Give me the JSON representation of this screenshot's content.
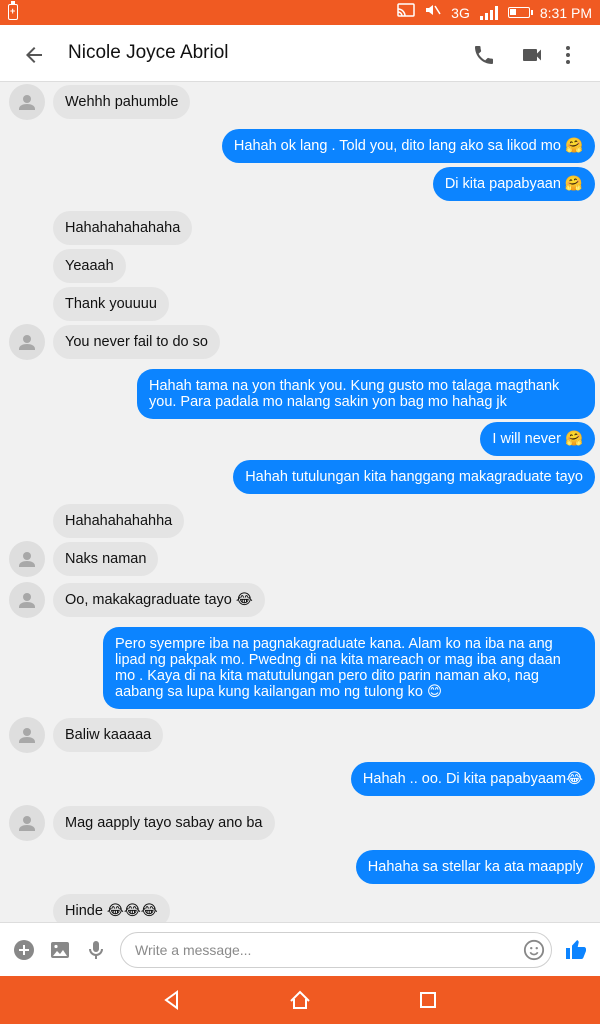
{
  "status_bar": {
    "network": "3G",
    "time": "8:31 PM"
  },
  "header": {
    "contact_name": "Nicole Joyce Abriol"
  },
  "messages": [
    {
      "side": "in",
      "text": "Wehhh pahumble",
      "avatar": true
    },
    {
      "side": "out",
      "text": "Hahah ok lang . Told you, dito lang ako sa likod mo 🤗"
    },
    {
      "side": "out",
      "text": "Di kita papabyaan 🤗"
    },
    {
      "side": "in",
      "text": "Hahahahahahaha",
      "avatar": false
    },
    {
      "side": "in",
      "text": "Yeaaah",
      "avatar": false
    },
    {
      "side": "in",
      "text": "Thank youuuu",
      "avatar": false
    },
    {
      "side": "in",
      "text": "You never fail to do so",
      "avatar": true
    },
    {
      "side": "out",
      "text": "Hahah tama na yon thank you. Kung gusto mo talaga magthank you. Para padala mo nalang sakin yon bag mo hahag jk"
    },
    {
      "side": "out",
      "text": "I will never 🤗"
    },
    {
      "side": "out",
      "text": "Hahah tutulungan kita hanggang makagraduate tayo"
    },
    {
      "side": "in",
      "text": "Hahahahahahha",
      "avatar": false
    },
    {
      "side": "in",
      "text": "Naks naman",
      "avatar": true
    },
    {
      "side": "in",
      "text": "Oo, makakagraduate tayo 😂",
      "avatar": true
    },
    {
      "side": "out",
      "text": "Pero syempre iba na pagnakagraduate kana. Alam ko na iba na ang lipad ng pakpak mo. Pwedng di na kita mareach or mag iba ang daan mo . Kaya di na kita matutulungan pero dito parin naman ako, nag aabang sa lupa kung kailangan mo ng tulong ko 😊"
    },
    {
      "side": "in",
      "text": "Baliw kaaaaa",
      "avatar": true
    },
    {
      "side": "out",
      "text": "Hahah .. oo. Di kita papabyaam😂"
    },
    {
      "side": "in",
      "text": "Mag aapply tayo sabay ano ba",
      "avatar": true
    },
    {
      "side": "out",
      "text": "Hahaha sa stellar ka ata maapply"
    },
    {
      "side": "in",
      "text": "Hinde 😂😂😂",
      "avatar": false
    }
  ],
  "composer": {
    "placeholder": "Write a message..."
  },
  "icons": {
    "accent": "#0c84ff",
    "status_bar_color": "#f05a22",
    "incoming_bubble": "#e4e4e4"
  }
}
